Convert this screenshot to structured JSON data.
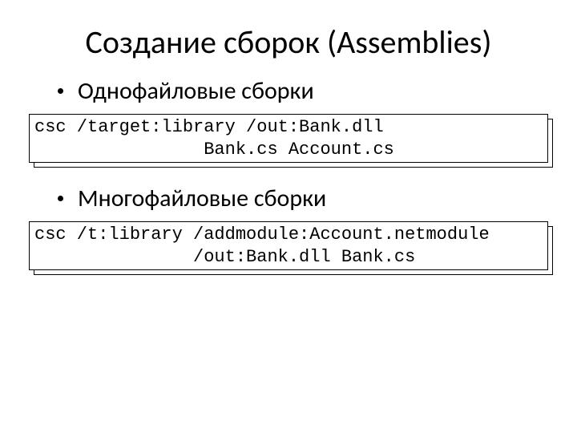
{
  "title": "Создание сборок (Assemblies)",
  "bullets": {
    "single": "Однофайловые сборки",
    "multi": "Многофайловые сборки"
  },
  "code": {
    "single": "csc /target:library /out:Bank.dll\n                Bank.cs Account.cs",
    "multi": "csc /t:library /addmodule:Account.netmodule\n               /out:Bank.dll Bank.cs"
  }
}
